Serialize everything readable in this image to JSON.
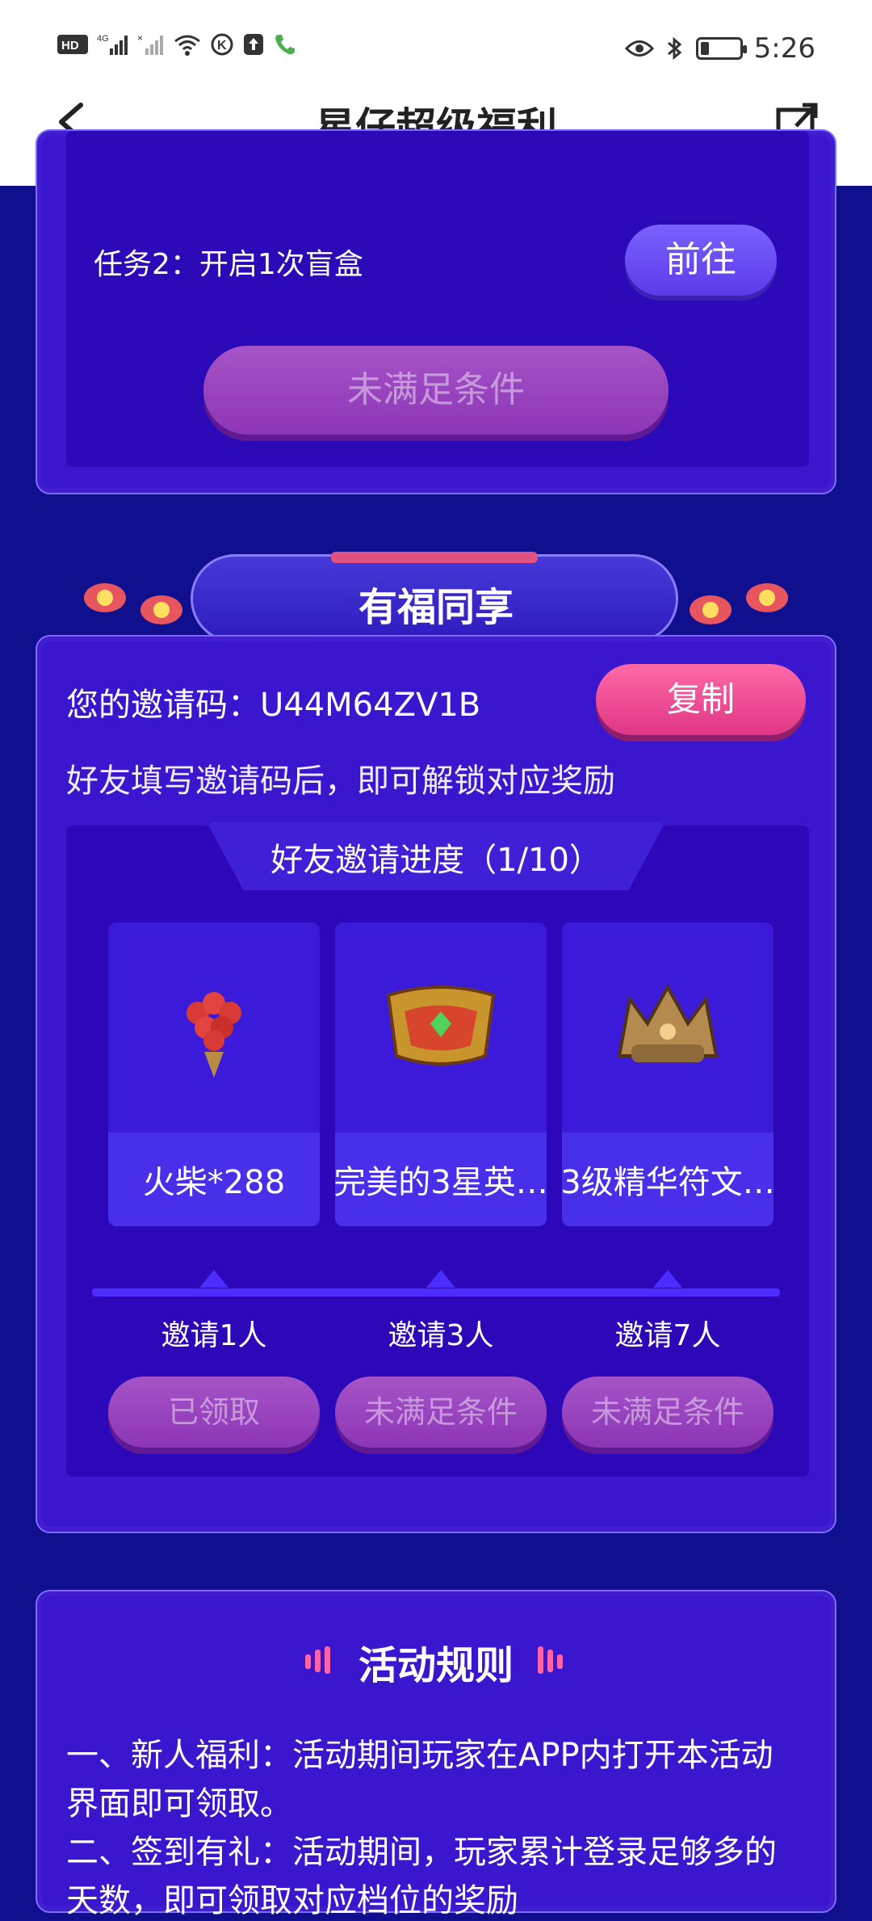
{
  "status_bar": {
    "left_icons": [
      "hd-icon",
      "4g-signal-icon",
      "signal-icon",
      "wifi-icon",
      "k-icon",
      "upload-icon",
      "call-icon"
    ],
    "right_icons": [
      "eye-icon",
      "bluetooth-icon",
      "battery-icon"
    ],
    "time": "5:26",
    "battery_level": 0.2
  },
  "header": {
    "title": "星仔超级福利",
    "back_icon": "back-arrow-icon",
    "share_icon": "share-icon"
  },
  "task_card": {
    "task2_text": "任务2：开启1次盲盒",
    "go_button": "前往",
    "claim_button": "未满足条件"
  },
  "invite_section": {
    "banner_title": "有福同享",
    "invite_code_label": "您的邀请码：U44M64ZV1B",
    "copy_button": "复制",
    "unlock_text": "好友填写邀请码后，即可解锁对应奖励",
    "progress_title": "好友邀请进度（1/10）",
    "progress_invited": 1,
    "progress_total": 10,
    "rewards": [
      {
        "name": "火柴*288",
        "icon": "matches-bouquet-icon",
        "requirement": "邀请1人",
        "button": "已领取"
      },
      {
        "name": "完美的3星英…",
        "icon": "hero-chest-icon",
        "requirement": "邀请3人",
        "button": "未满足条件"
      },
      {
        "name": "3级精华符文…",
        "icon": "rune-crown-icon",
        "requirement": "邀请7人",
        "button": "未满足条件"
      }
    ]
  },
  "rules": {
    "title": "活动规则",
    "lines": [
      "一、新人福利：活动期间玩家在APP内打开本活动",
      "界面即可领取。",
      "二、签到有礼：活动期间，玩家累计登录足够多的",
      "天数，即可领取对应档位的奖励"
    ]
  },
  "colors": {
    "background": "#10108e",
    "card": "#3a17cf",
    "panel": "#2c08b8",
    "pink_button": "#e03686",
    "purple_disabled": "#8c35b6"
  }
}
